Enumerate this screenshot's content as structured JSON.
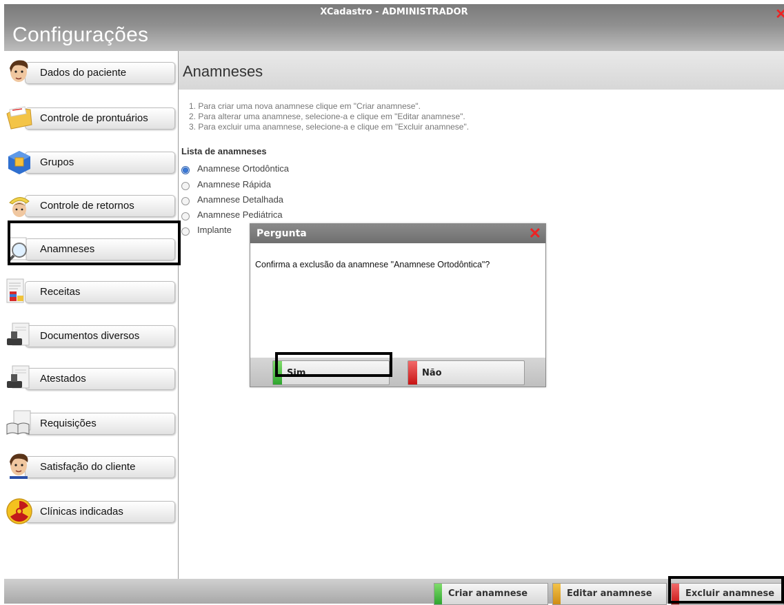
{
  "window": {
    "title": "XCadastro - ADMINISTRADOR",
    "heading": "Configurações"
  },
  "sidebar": {
    "items": [
      {
        "label": "Dados do paciente",
        "icon": "man-face-icon"
      },
      {
        "label": "Controle de prontuários",
        "icon": "folder-icon"
      },
      {
        "label": "Grupos",
        "icon": "cube-icon"
      },
      {
        "label": "Controle de retornos",
        "icon": "return-arrow-icon"
      },
      {
        "label": "Anamneses",
        "icon": "magnifier-icon"
      },
      {
        "label": "Receitas",
        "icon": "prescription-icon"
      },
      {
        "label": "Documentos diversos",
        "icon": "stamp-document-icon"
      },
      {
        "label": "Atestados",
        "icon": "stamp-document-icon"
      },
      {
        "label": "Requisições",
        "icon": "book-document-icon"
      },
      {
        "label": "Satisfação do cliente",
        "icon": "man-face-icon"
      },
      {
        "label": "Clínicas indicadas",
        "icon": "radiation-icon"
      }
    ]
  },
  "main": {
    "title": "Anamneses",
    "instructions": [
      "1. Para criar uma nova anamnese clique em \"Criar anamnese\".",
      "2. Para alterar uma anamnese, selecione-a e clique em \"Editar anamnese\".",
      "3. Para excluir uma anamnese, selecione-a e clique em \"Excluir anamnese\"."
    ],
    "list_title": "Lista de anamneses",
    "list": [
      {
        "label": "Anamnese Ortodôntica",
        "selected": true
      },
      {
        "label": "Anamnese Rápida",
        "selected": false
      },
      {
        "label": "Anamnese Detalhada",
        "selected": false
      },
      {
        "label": "Anamnese Pediátrica",
        "selected": false
      },
      {
        "label": "Implante",
        "selected": false
      }
    ]
  },
  "dialog": {
    "title": "Pergunta",
    "message": "Confirma a exclusão da anamnese \"Anamnese Ortodôntica\"?",
    "yes_label": "Sim",
    "no_label": "Não"
  },
  "bottom": {
    "create_label": "Criar anamnese",
    "edit_label": "Editar anamnese",
    "delete_label": "Excluir anamnese"
  },
  "colors": {
    "green": "#3fb53f",
    "orange": "#e0a21c",
    "red": "#e11b1b",
    "titlebar": "#8a8a8a"
  }
}
